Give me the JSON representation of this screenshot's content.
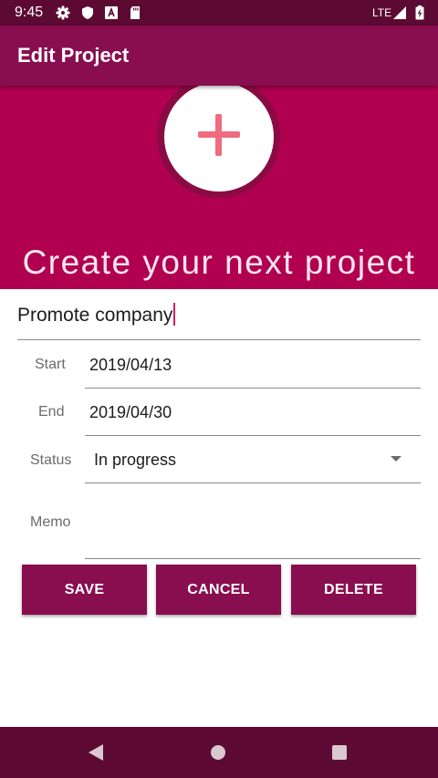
{
  "status_bar": {
    "time": "9:45",
    "network": "LTE",
    "icons": [
      "gear-icon",
      "shield-icon",
      "a-icon",
      "sd-card-icon",
      "signal-icon",
      "battery-icon"
    ]
  },
  "app_bar": {
    "title": "Edit Project"
  },
  "hero": {
    "icon": "add-icon",
    "caption": "Create your next project",
    "colors": {
      "background": "#b0004f",
      "icon": "#f06a80"
    }
  },
  "form": {
    "name_value": "Promote company",
    "start": {
      "label": "Start",
      "value": "2019/04/13"
    },
    "end": {
      "label": "End",
      "value": "2019/04/30"
    },
    "status": {
      "label": "Status",
      "value": "In progress"
    },
    "memo": {
      "label": "Memo",
      "value": ""
    }
  },
  "buttons": {
    "save": "SAVE",
    "cancel": "CANCEL",
    "delete": "DELETE"
  },
  "nav_bar": {
    "icons": [
      "back-icon",
      "home-icon",
      "recents-icon"
    ]
  },
  "theme": {
    "primary": "#880e4f",
    "primary_dark": "#5c0a33",
    "accent": "#d81b60"
  }
}
